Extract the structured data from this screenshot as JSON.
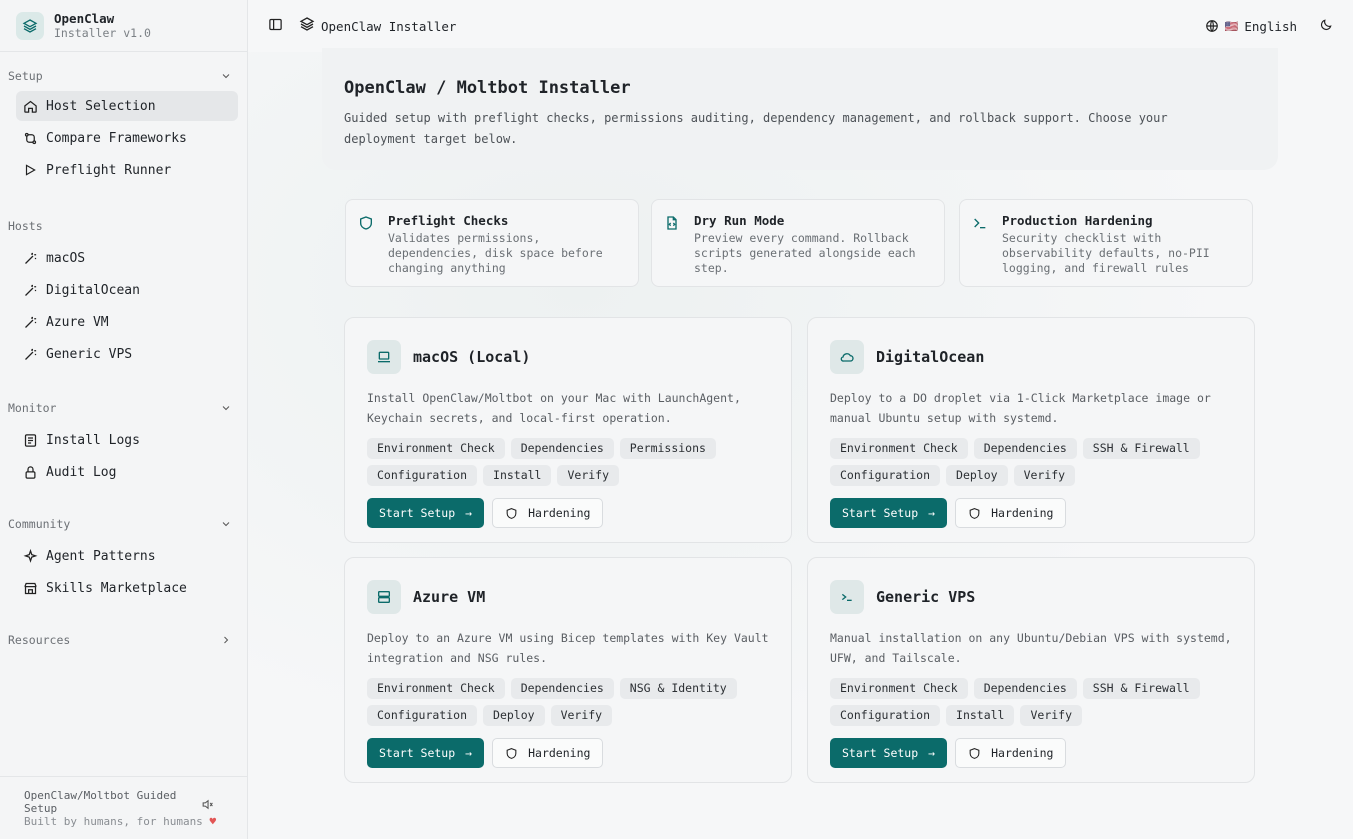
{
  "brand": {
    "name": "OpenClaw",
    "version": "Installer v1.0"
  },
  "sidebar": {
    "groups": [
      {
        "label": "Setup",
        "items": [
          {
            "label": "Host Selection",
            "icon": "home-icon",
            "active": true
          },
          {
            "label": "Compare Frameworks",
            "icon": "compare-icon"
          },
          {
            "label": "Preflight Runner",
            "icon": "play-icon"
          }
        ]
      },
      {
        "label": "Hosts",
        "items": [
          {
            "label": "macOS",
            "icon": "wand-icon"
          },
          {
            "label": "DigitalOcean",
            "icon": "wand-icon"
          },
          {
            "label": "Azure VM",
            "icon": "wand-icon"
          },
          {
            "label": "Generic VPS",
            "icon": "wand-icon"
          }
        ]
      },
      {
        "label": "Monitor",
        "items": [
          {
            "label": "Install Logs",
            "icon": "logs-icon"
          },
          {
            "label": "Audit Log",
            "icon": "lock-icon"
          }
        ]
      },
      {
        "label": "Community",
        "items": [
          {
            "label": "Agent Patterns",
            "icon": "sparkles-icon"
          },
          {
            "label": "Skills Marketplace",
            "icon": "store-icon"
          }
        ]
      },
      {
        "label": "Resources",
        "items": []
      }
    ],
    "footer": {
      "line1": "OpenClaw/Moltbot Guided",
      "line2": "Setup",
      "line3": "Built by humans, for humans"
    }
  },
  "topbar": {
    "title": "OpenClaw Installer",
    "language": "English",
    "flag": "🇺🇸"
  },
  "hero": {
    "title": "OpenClaw / Moltbot Installer",
    "description": "Guided setup with preflight checks, permissions auditing, dependency management, and rollback support. Choose your deployment target below."
  },
  "features": [
    {
      "title": "Preflight Checks",
      "desc": "Validates permissions, dependencies, disk space before changing anything",
      "icon": "shield-icon"
    },
    {
      "title": "Dry Run Mode",
      "desc": "Preview every command. Rollback scripts generated alongside each step.",
      "icon": "file-code-icon"
    },
    {
      "title": "Production Hardening",
      "desc": "Security checklist with observability defaults, no-PII logging, and firewall rules",
      "icon": "terminal-icon"
    }
  ],
  "hosts": [
    {
      "title": "macOS (Local)",
      "icon": "laptop-icon",
      "desc": "Install OpenClaw/Moltbot on your Mac with LaunchAgent, Keychain secrets, and local-first operation.",
      "tags": [
        "Environment Check",
        "Dependencies",
        "Permissions",
        "Configuration",
        "Install",
        "Verify"
      ]
    },
    {
      "title": "DigitalOcean",
      "icon": "cloud-icon",
      "desc": "Deploy to a DO droplet via 1-Click Marketplace image or manual Ubuntu setup with systemd.",
      "tags": [
        "Environment Check",
        "Dependencies",
        "SSH & Firewall",
        "Configuration",
        "Deploy",
        "Verify"
      ]
    },
    {
      "title": "Azure VM",
      "icon": "server-icon",
      "desc": "Deploy to an Azure VM using Bicep templates with Key Vault integration and NSG rules.",
      "tags": [
        "Environment Check",
        "Dependencies",
        "NSG & Identity",
        "Configuration",
        "Deploy",
        "Verify"
      ]
    },
    {
      "title": "Generic VPS",
      "icon": "terminal-icon",
      "desc": "Manual installation on any Ubuntu/Debian VPS with systemd, UFW, and Tailscale.",
      "tags": [
        "Environment Check",
        "Dependencies",
        "SSH & Firewall",
        "Configuration",
        "Install",
        "Verify"
      ]
    }
  ],
  "buttons": {
    "start": "Start Setup",
    "hardening": "Hardening"
  },
  "colors": {
    "accent": "#0b6b6a",
    "heart": "#e25555"
  }
}
